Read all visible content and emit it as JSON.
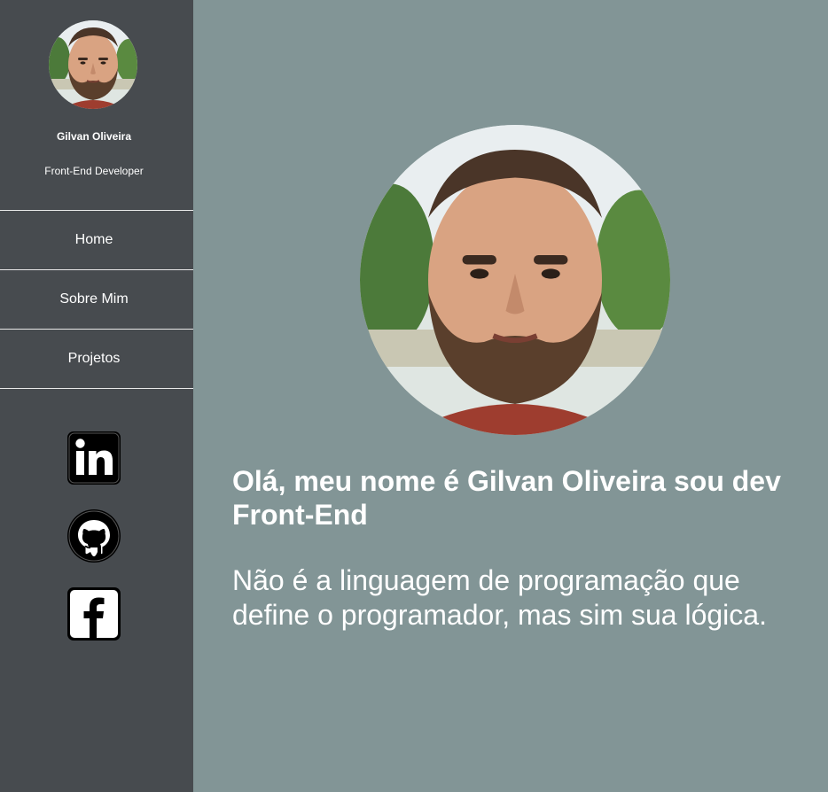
{
  "sidebar": {
    "name": "Gilvan Oliveira",
    "role": "Front-End Developer",
    "nav": [
      {
        "label": "Home"
      },
      {
        "label": "Sobre Mim"
      },
      {
        "label": "Projetos"
      }
    ],
    "social": [
      {
        "icon": "linkedin-icon"
      },
      {
        "icon": "github-icon"
      },
      {
        "icon": "facebook-icon"
      }
    ]
  },
  "main": {
    "headline": "Olá, meu nome é Gilvan Oliveira sou dev Front-End",
    "quote": "Não é a linguagem de programação que define o programador, mas sim sua lógica."
  },
  "colors": {
    "sidebar_bg": "#474b4f",
    "main_bg": "#829596",
    "text": "#ffffff"
  }
}
